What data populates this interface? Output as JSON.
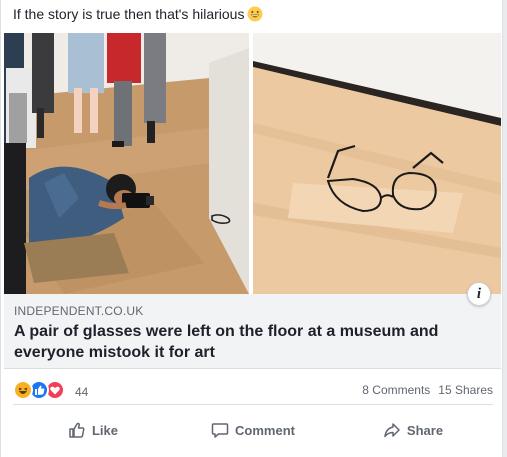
{
  "post": {
    "caption": "If the story is true then that's hilarious",
    "caption_emoji": "grinning-face-emoji"
  },
  "link": {
    "source": "INDEPENDENT.CO.UK",
    "headline": "A pair of glasses were left on the floor at a museum and everyone mistook it for art",
    "info_label": "i"
  },
  "stats": {
    "reaction_count": "44",
    "reactions": [
      "haha",
      "like",
      "love"
    ],
    "comments": "8 Comments",
    "shares": "15 Shares"
  },
  "actions": {
    "like": "Like",
    "comment": "Comment",
    "share": "Share"
  },
  "colors": {
    "like_blue": "#1877f2",
    "love_red": "#f33e58",
    "haha_yellow": "#f7b125",
    "muted_text": "#606770"
  }
}
